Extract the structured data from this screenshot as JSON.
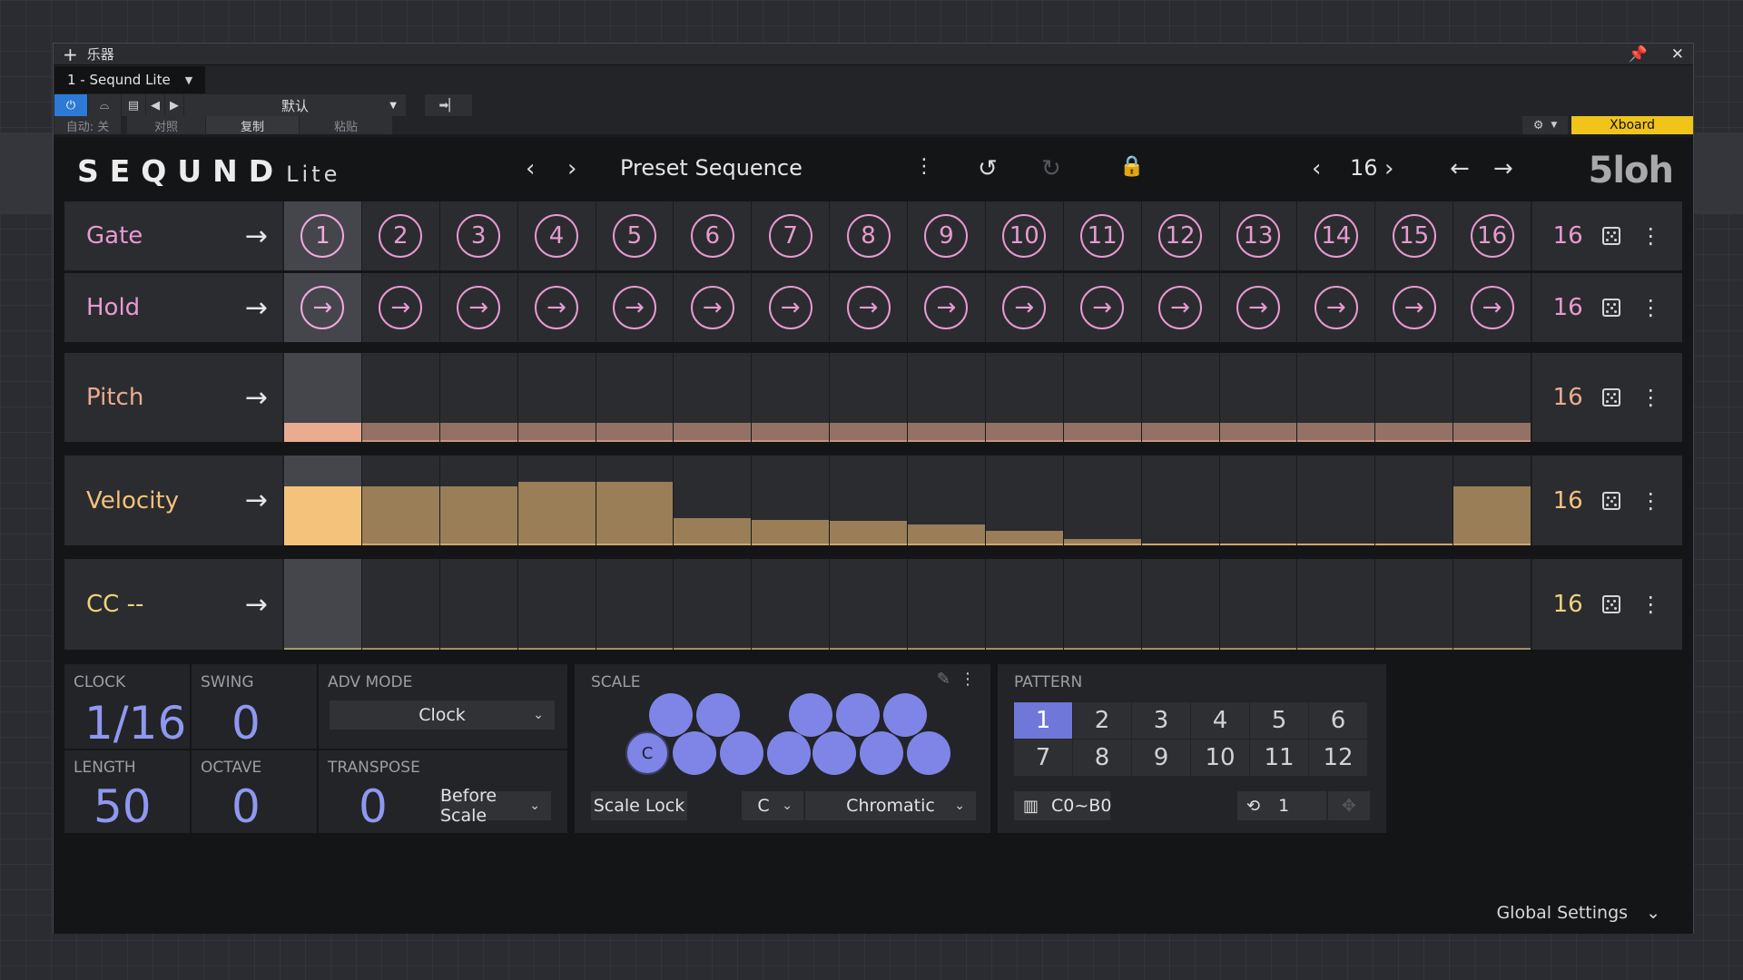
{
  "window": {
    "title": "乐器",
    "preset_tab": "1 - Seqund Lite"
  },
  "host": {
    "preset_dropdown": "默认",
    "auto_label": "自动: 关",
    "compare_label": "对照",
    "copy_label": "复制",
    "paste_label": "粘贴",
    "device_button": "Xboard"
  },
  "plugin": {
    "logo": "SEQUND",
    "logo_suffix": "Lite",
    "preset_name": "Preset Sequence",
    "step_count": "16",
    "brand": "5loh"
  },
  "lanes": {
    "gate": {
      "name": "Gate",
      "length": "16",
      "steps": [
        "1",
        "2",
        "3",
        "4",
        "5",
        "6",
        "7",
        "8",
        "9",
        "10",
        "11",
        "12",
        "13",
        "14",
        "15",
        "16"
      ]
    },
    "hold": {
      "name": "Hold",
      "length": "16"
    },
    "pitch": {
      "name": "Pitch",
      "length": "16",
      "levels": [
        0.27,
        0.27,
        0.27,
        0.27,
        0.27,
        0.27,
        0.27,
        0.27,
        0.27,
        0.27,
        0.27,
        0.27,
        0.27,
        0.27,
        0.27,
        0.27
      ]
    },
    "velocity": {
      "name": "Velocity",
      "length": "16",
      "levels": [
        0.8,
        0.8,
        0.8,
        0.87,
        0.87,
        0.37,
        0.35,
        0.33,
        0.29,
        0.2,
        0.09,
        0.02,
        0.02,
        0.02,
        0.02,
        0.8
      ]
    },
    "cc": {
      "name": "CC --",
      "length": "16"
    }
  },
  "colors": {
    "gate": "#e89ad0",
    "pitch": "#e9ac90",
    "velocity": "#f4c27a",
    "cc": "#f0d27a"
  },
  "params": {
    "clock_label": "CLOCK",
    "clock_value": "1/16",
    "swing_label": "SWING",
    "swing_value": "0",
    "adv_mode_label": "ADV MODE",
    "adv_mode_value": "Clock",
    "length_label": "LENGTH",
    "length_value": "50",
    "octave_label": "OCTAVE",
    "octave_value": "0",
    "transpose_label": "TRANSPOSE",
    "transpose_value": "0",
    "transpose_mode": "Before Scale"
  },
  "scale": {
    "label": "SCALE",
    "root_dot_label": "C",
    "lock_label": "Scale Lock",
    "root": "C",
    "type": "Chromatic"
  },
  "pattern": {
    "label": "PATTERN",
    "cells": [
      "1",
      "2",
      "3",
      "4",
      "5",
      "6",
      "7",
      "8",
      "9",
      "10",
      "11",
      "12"
    ],
    "selected": "1",
    "range": "C0~B0",
    "repeat": "1"
  },
  "footer": {
    "global_settings": "Global Settings"
  }
}
